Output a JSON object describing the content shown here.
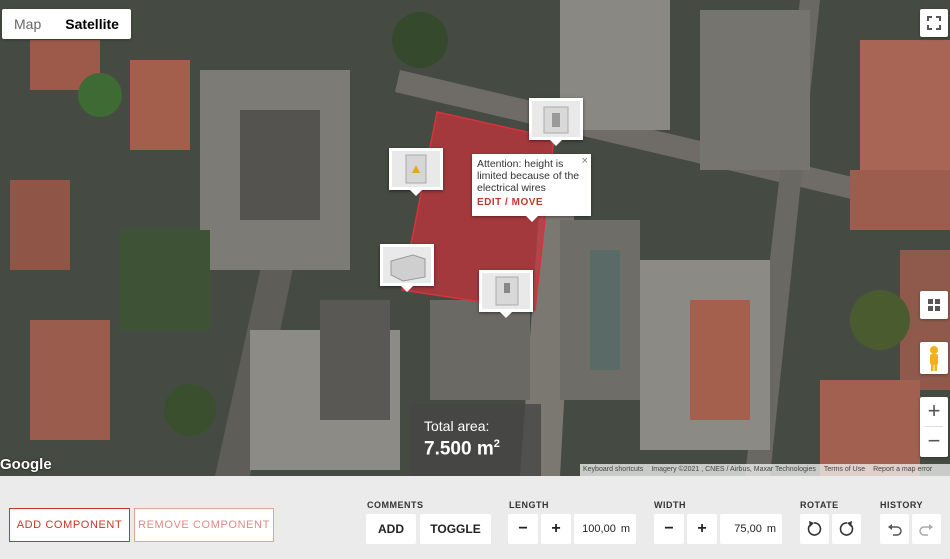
{
  "map": {
    "type_options": [
      "Map",
      "Satellite"
    ],
    "active_type": "Satellite",
    "popup": {
      "text": "Attention: height is limited because of the electrical wires",
      "action": "EDIT / MOVE",
      "close_glyph": "×"
    },
    "area": {
      "label": "Total area:",
      "value": "7.500 m",
      "unit_sup": "2"
    },
    "logo": "Google",
    "attribution": [
      "Keyboard shortcuts",
      "Imagery ©2021 , CNES / Airbus, Maxar Technologies",
      "Terms of Use",
      "Report a map error"
    ],
    "zoom_in": "+",
    "zoom_out": "−",
    "polygon_color": "#c8323c"
  },
  "toolbar": {
    "add_component": "ADD COMPONENT",
    "remove_component": "REMOVE COMPONENT",
    "comments": {
      "label": "COMMENTS",
      "add": "ADD",
      "toggle": "TOGGLE"
    },
    "length": {
      "label": "LENGTH",
      "minus": "−",
      "plus": "+",
      "value": "100,00",
      "unit": "m"
    },
    "width": {
      "label": "WIDTH",
      "minus": "−",
      "plus": "+",
      "value": "75,00",
      "unit": "m"
    },
    "rotate": {
      "label": "ROTATE"
    },
    "history": {
      "label": "HISTORY"
    },
    "accent_color": "#c0392b"
  }
}
